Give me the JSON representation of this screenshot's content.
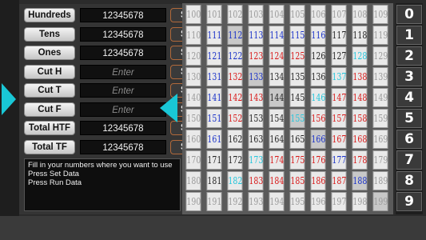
{
  "controls": [
    {
      "label": "Hundreds",
      "value": "12345678",
      "placeholder": "",
      "set_label": "Set"
    },
    {
      "label": "Tens",
      "value": "12345678",
      "placeholder": "",
      "set_label": "Set"
    },
    {
      "label": "Ones",
      "value": "12345678",
      "placeholder": "",
      "set_label": "Set"
    },
    {
      "label": "Cut H",
      "value": "",
      "placeholder": "Enter",
      "set_label": "Set"
    },
    {
      "label": "Cut T",
      "value": "",
      "placeholder": "Enter",
      "set_label": "Set"
    },
    {
      "label": "Cut F",
      "value": "",
      "placeholder": "Enter",
      "set_label": "Set"
    },
    {
      "label": "Total HTF",
      "value": "12345678",
      "placeholder": "",
      "set_label": "Set"
    },
    {
      "label": "Total TF",
      "value": "12345678",
      "placeholder": "",
      "set_label": "Set"
    }
  ],
  "help": {
    "line1": "Fill in your numbers where you want to use",
    "line2": "Press Set Data",
    "line3": "Press Run Data"
  },
  "grid": {
    "rows": [
      [
        "100",
        "101",
        "102",
        "103",
        "104",
        "105",
        "106",
        "107",
        "108",
        "109"
      ],
      [
        "110",
        "111",
        "112",
        "113",
        "114",
        "115",
        "116",
        "117",
        "118",
        "119"
      ],
      [
        "120",
        "121",
        "122",
        "123",
        "124",
        "125",
        "126",
        "127",
        "128",
        "129"
      ],
      [
        "130",
        "131",
        "132",
        "133",
        "134",
        "135",
        "136",
        "137",
        "138",
        "139"
      ],
      [
        "140",
        "141",
        "142",
        "143",
        "144",
        "145",
        "146",
        "147",
        "148",
        "149"
      ],
      [
        "150",
        "151",
        "152",
        "153",
        "154",
        "155",
        "156",
        "157",
        "158",
        "159"
      ],
      [
        "160",
        "161",
        "162",
        "163",
        "164",
        "165",
        "166",
        "167",
        "168",
        "169"
      ],
      [
        "170",
        "171",
        "172",
        "173",
        "174",
        "175",
        "176",
        "177",
        "178",
        "179"
      ],
      [
        "180",
        "181",
        "182",
        "183",
        "184",
        "185",
        "186",
        "187",
        "188",
        "189"
      ],
      [
        "190",
        "191",
        "192",
        "193",
        "194",
        "195",
        "196",
        "197",
        "198",
        "199"
      ]
    ],
    "colors": [
      [
        "grey",
        "grey",
        "grey",
        "grey",
        "grey",
        "grey",
        "grey",
        "grey",
        "grey",
        "grey"
      ],
      [
        "grey",
        "blue",
        "blue",
        "blue",
        "blue",
        "blue",
        "blue",
        "black",
        "black",
        "grey"
      ],
      [
        "grey",
        "blue",
        "blue",
        "red",
        "red",
        "red",
        "black",
        "black",
        "cyan",
        "grey"
      ],
      [
        "grey",
        "blue",
        "red",
        "blue",
        "black",
        "black",
        "black",
        "cyan",
        "red",
        "grey"
      ],
      [
        "grey",
        "blue",
        "red",
        "red",
        "black",
        "black",
        "cyan",
        "red",
        "red",
        "grey"
      ],
      [
        "grey",
        "blue",
        "red",
        "black",
        "black",
        "cyan",
        "red",
        "red",
        "red",
        "grey"
      ],
      [
        "grey",
        "blue",
        "black",
        "black",
        "black",
        "black",
        "blue",
        "red",
        "red",
        "grey"
      ],
      [
        "grey",
        "black",
        "black",
        "cyan",
        "red",
        "red",
        "red",
        "blue",
        "red",
        "grey"
      ],
      [
        "grey",
        "black",
        "cyan",
        "red",
        "red",
        "red",
        "red",
        "red",
        "blue",
        "grey"
      ],
      [
        "grey",
        "grey",
        "grey",
        "grey",
        "grey",
        "grey",
        "grey",
        "grey",
        "grey",
        "grey"
      ]
    ],
    "highlighted": [
      [
        "1",
        "2"
      ],
      [
        "3",
        "3"
      ],
      [
        "4",
        "4"
      ],
      [
        "5",
        "5"
      ],
      [
        "6",
        "6"
      ],
      [
        "8",
        "8"
      ],
      [
        "9",
        "9"
      ]
    ]
  },
  "digits": [
    "0",
    "1",
    "2",
    "3",
    "4",
    "5",
    "6",
    "7",
    "8",
    "9"
  ]
}
